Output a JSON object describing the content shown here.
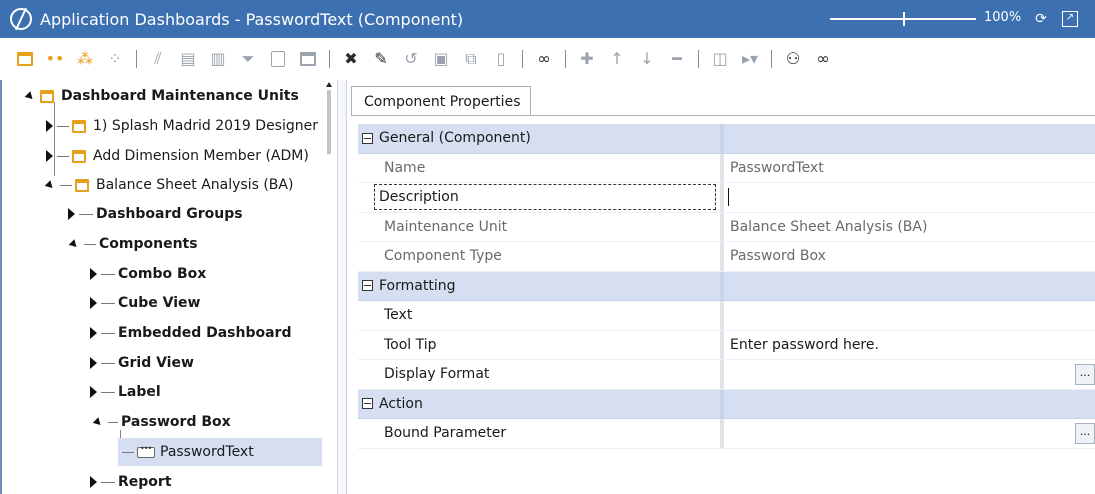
{
  "window": {
    "title": "Application Dashboards - PasswordText (Component)",
    "zoom": "100%"
  },
  "tree": {
    "root": "Dashboard Maintenance Units",
    "units": [
      "1) Splash Madrid 2019 Designer",
      "Add Dimension Member (ADM)",
      "Balance Sheet Analysis (BA)"
    ],
    "ba_children": [
      "Dashboard Groups",
      "Components"
    ],
    "component_types": [
      "Combo Box",
      "Cube View",
      "Embedded Dashboard",
      "Grid View",
      "Label",
      "Password Box",
      "Report"
    ],
    "selected_leaf": "PasswordText"
  },
  "properties": {
    "tab": "Component Properties",
    "categories": {
      "general": "General (Component)",
      "formatting": "Formatting",
      "action": "Action"
    },
    "rows": {
      "name": {
        "label": "Name",
        "value": "PasswordText"
      },
      "description": {
        "label": "Description",
        "value": ""
      },
      "maintenance_unit": {
        "label": "Maintenance Unit",
        "value": "Balance Sheet Analysis (BA)"
      },
      "component_type": {
        "label": "Component Type",
        "value": "Password Box"
      },
      "text": {
        "label": "Text",
        "value": ""
      },
      "tool_tip": {
        "label": "Tool Tip",
        "value": "Enter password here."
      },
      "display_format": {
        "label": "Display Format",
        "value": ""
      },
      "bound_parameter": {
        "label": "Bound Parameter",
        "value": ""
      }
    },
    "ellipsis": "..."
  }
}
